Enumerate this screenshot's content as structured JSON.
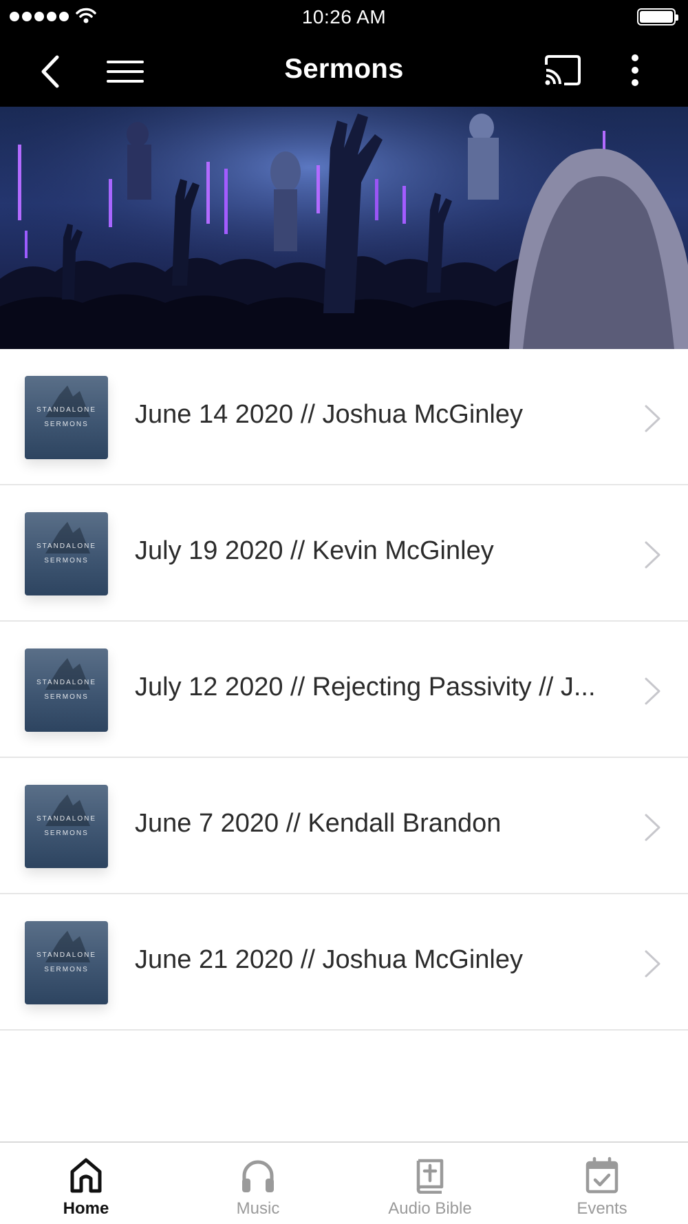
{
  "status_bar": {
    "time": "10:26 AM"
  },
  "nav": {
    "title": "Sermons",
    "icons": [
      "back-chevron-icon",
      "hamburger-menu-icon",
      "cast-icon",
      "more-vertical-icon"
    ]
  },
  "hero": {
    "image": "concert-worship-crowd-photo"
  },
  "sermons": [
    {
      "title": "June 14 2020 // Joshua McGinley",
      "thumb_line1": "STANDALONE",
      "thumb_line2": "SERMONS"
    },
    {
      "title": "July 19 2020 // Kevin McGinley",
      "thumb_line1": "STANDALONE",
      "thumb_line2": "SERMONS"
    },
    {
      "title": "July 12 2020 // Rejecting Passivity // J...",
      "thumb_line1": "STANDALONE",
      "thumb_line2": "SERMONS"
    },
    {
      "title": "June 7 2020 // Kendall Brandon",
      "thumb_line1": "STANDALONE",
      "thumb_line2": "SERMONS"
    },
    {
      "title": "June 21 2020 // Joshua McGinley",
      "thumb_line1": "STANDALONE",
      "thumb_line2": "SERMONS"
    }
  ],
  "tabs": [
    {
      "label": "Home",
      "icon": "home-icon",
      "active": true
    },
    {
      "label": "Music",
      "icon": "headphones-icon",
      "active": false
    },
    {
      "label": "Audio Bible",
      "icon": "bible-icon",
      "active": false
    },
    {
      "label": "Events",
      "icon": "calendar-check-icon",
      "active": false
    }
  ],
  "colors": {
    "bar_bg": "#000000",
    "text_primary": "#2b2b2b",
    "tab_inactive": "#9a9a9a",
    "tab_active": "#111111"
  }
}
